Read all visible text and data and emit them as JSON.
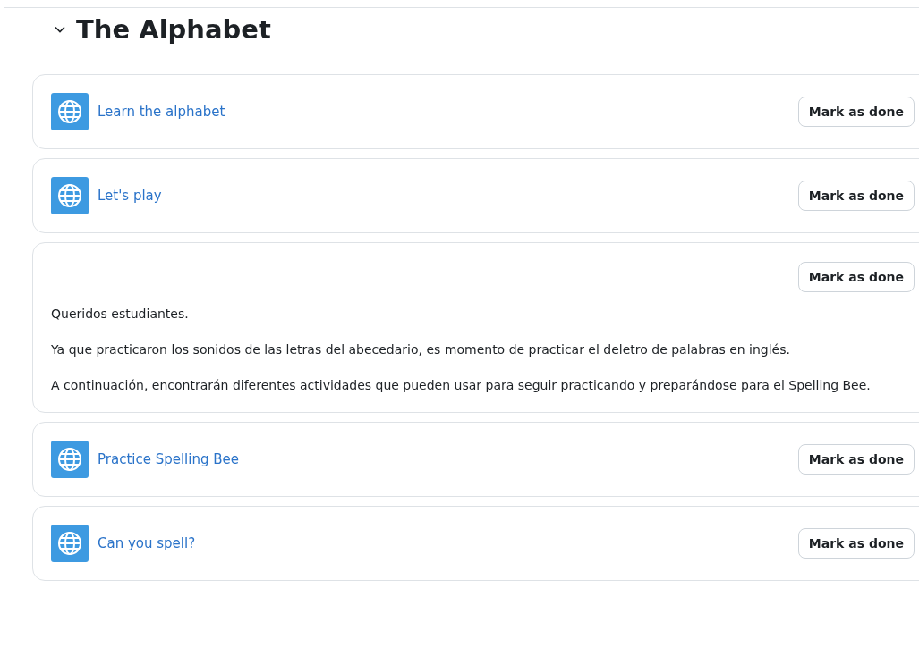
{
  "section": {
    "title": "The Alphabet",
    "expanded": true
  },
  "activities": [
    {
      "kind": "url",
      "name": "Learn the alphabet",
      "button": "Mark as done"
    },
    {
      "kind": "url",
      "name": "Let's play",
      "button": "Mark as done"
    },
    {
      "kind": "label",
      "button": "Mark as done",
      "paragraphs": [
        "Queridos estudiantes.",
        "Ya que practicaron los sonidos de las letras del abecedario, es momento de practicar el deletro de palabras en inglés.",
        "A continuación, encontrarán diferentes actividades que pueden usar para seguir practicando y preparándose para el Spelling Bee."
      ]
    },
    {
      "kind": "url",
      "name": "Practice Spelling Bee",
      "button": "Mark as done"
    },
    {
      "kind": "url",
      "name": "Can you spell?",
      "button": "Mark as done"
    }
  ]
}
